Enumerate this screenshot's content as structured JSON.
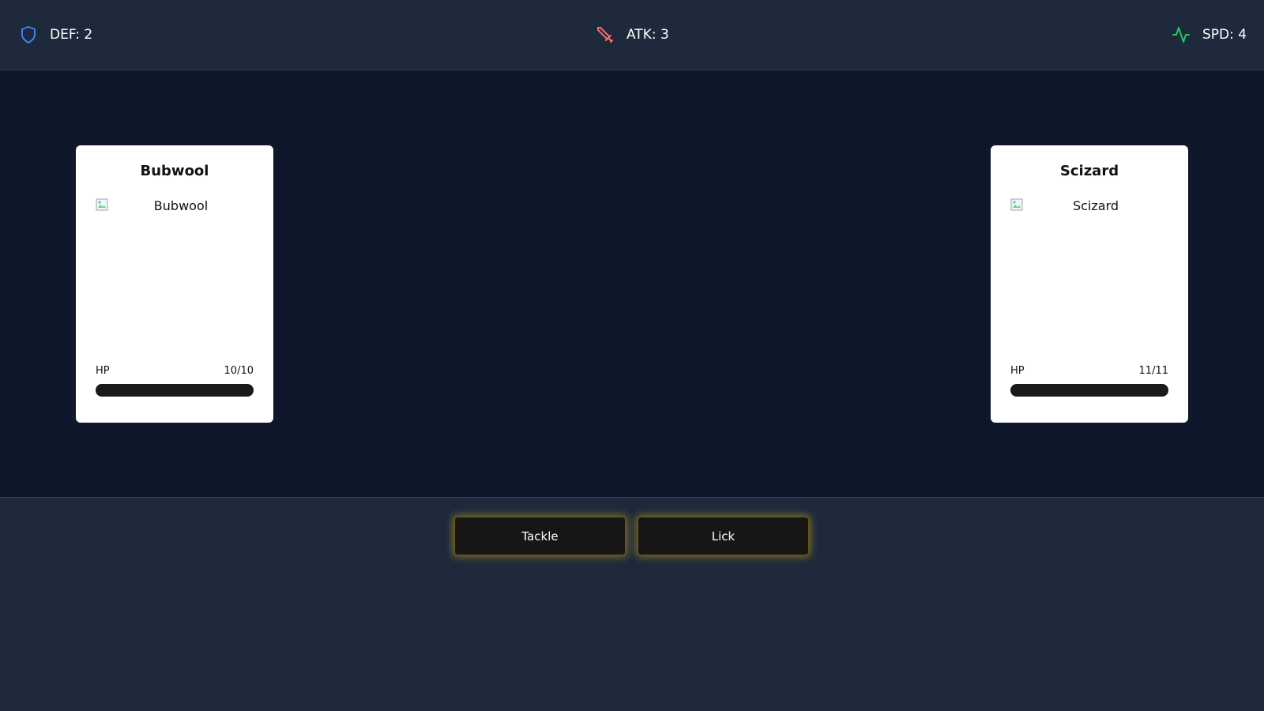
{
  "stats": [
    {
      "key": "def",
      "label": "DEF: 2",
      "icon": "shield-icon",
      "color": "#3b82f6"
    },
    {
      "key": "atk",
      "label": "ATK: 3",
      "icon": "sword-icon",
      "color": "#f87171"
    },
    {
      "key": "spd",
      "label": "SPD: 4",
      "icon": "activity-icon",
      "color": "#22c55e"
    }
  ],
  "player": {
    "name": "Bubwool",
    "image_alt": "Bubwool",
    "hp_label": "HP",
    "hp_text": "10/10",
    "hp_fraction": 1.0
  },
  "opponent": {
    "name": "Scizard",
    "image_alt": "Scizard",
    "hp_label": "HP",
    "hp_text": "11/11",
    "hp_fraction": 1.0
  },
  "moves": [
    {
      "label": "Tackle"
    },
    {
      "label": "Lick"
    }
  ],
  "colors": {
    "statbar_bg": "#1e293b",
    "arena_bg": "#0f172a",
    "card_bg": "#ffffff",
    "hp_bar": "#1a1a1a",
    "button_bg": "#161616",
    "button_glow": "#caaa1e"
  }
}
